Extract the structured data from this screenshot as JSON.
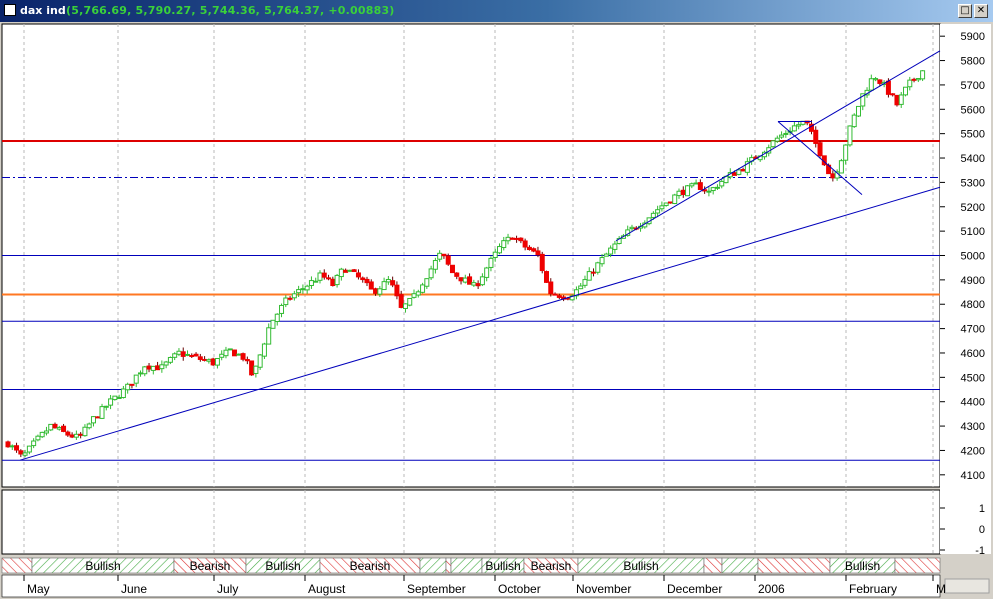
{
  "window": {
    "title": "dax ind",
    "quote": "(5,766.69, 5,790.27, 5,744.36, 5,764.37, +0.00883)",
    "controls": {
      "maximize": "□",
      "close": "✕"
    }
  },
  "colors": {
    "plot_bg": "#ffffff",
    "up_candle": "#33bb33",
    "down_candle": "#ee0000",
    "trend_lines": "#0000bb",
    "resistance_line": "#dd0000",
    "support_line": "#ff7722",
    "grid": "#b8b8b8",
    "bullish_hatch": "#44aa44",
    "bearish_hatch": "#dd3333"
  },
  "chart_data": {
    "type": "candlestick",
    "title": "dax ind",
    "ylim": [
      4050,
      5950
    ],
    "y_ticks": [
      4100,
      4200,
      4300,
      4400,
      4500,
      4600,
      4700,
      4800,
      4900,
      5000,
      5100,
      5200,
      5300,
      5400,
      5500,
      5600,
      5700,
      5800,
      5900
    ],
    "x_tick_labels": [
      "May",
      "June",
      "July",
      "August",
      "September",
      "October",
      "November",
      "December",
      "2006",
      "February",
      "M"
    ],
    "close_series_weekly": [
      {
        "t": 0,
        "c": 4230
      },
      {
        "t": 5,
        "c": 4170
      },
      {
        "t": 10,
        "c": 4240
      },
      {
        "t": 15,
        "c": 4300
      },
      {
        "t": 20,
        "c": 4270
      },
      {
        "t": 25,
        "c": 4250
      },
      {
        "t": 30,
        "c": 4330
      },
      {
        "t": 36,
        "c": 4400
      },
      {
        "t": 42,
        "c": 4460
      },
      {
        "t": 48,
        "c": 4550
      },
      {
        "t": 54,
        "c": 4540
      },
      {
        "t": 60,
        "c": 4600
      },
      {
        "t": 66,
        "c": 4580
      },
      {
        "t": 72,
        "c": 4560
      },
      {
        "t": 78,
        "c": 4610
      },
      {
        "t": 83,
        "c": 4580
      },
      {
        "t": 86,
        "c": 4500
      },
      {
        "t": 92,
        "c": 4720
      },
      {
        "t": 98,
        "c": 4820
      },
      {
        "t": 104,
        "c": 4870
      },
      {
        "t": 110,
        "c": 4920
      },
      {
        "t": 114,
        "c": 4880
      },
      {
        "t": 118,
        "c": 4950
      },
      {
        "t": 124,
        "c": 4900
      },
      {
        "t": 128,
        "c": 4850
      },
      {
        "t": 134,
        "c": 4900
      },
      {
        "t": 138,
        "c": 4780
      },
      {
        "t": 142,
        "c": 4820
      },
      {
        "t": 146,
        "c": 4900
      },
      {
        "t": 152,
        "c": 5010
      },
      {
        "t": 156,
        "c": 4930
      },
      {
        "t": 160,
        "c": 4900
      },
      {
        "t": 164,
        "c": 4870
      },
      {
        "t": 168,
        "c": 4950
      },
      {
        "t": 173,
        "c": 5040
      },
      {
        "t": 177,
        "c": 5080
      },
      {
        "t": 181,
        "c": 5040
      },
      {
        "t": 186,
        "c": 5000
      },
      {
        "t": 190,
        "c": 4850
      },
      {
        "t": 196,
        "c": 4830
      },
      {
        "t": 200,
        "c": 4860
      },
      {
        "t": 206,
        "c": 4950
      },
      {
        "t": 212,
        "c": 5030
      },
      {
        "t": 218,
        "c": 5100
      },
      {
        "t": 224,
        "c": 5150
      },
      {
        "t": 230,
        "c": 5210
      },
      {
        "t": 236,
        "c": 5260
      },
      {
        "t": 242,
        "c": 5290
      },
      {
        "t": 246,
        "c": 5260
      },
      {
        "t": 252,
        "c": 5320
      },
      {
        "t": 258,
        "c": 5360
      },
      {
        "t": 264,
        "c": 5420
      },
      {
        "t": 270,
        "c": 5480
      },
      {
        "t": 276,
        "c": 5530
      },
      {
        "t": 280,
        "c": 5550
      },
      {
        "t": 283,
        "c": 5470
      },
      {
        "t": 286,
        "c": 5400
      },
      {
        "t": 289,
        "c": 5310
      },
      {
        "t": 292,
        "c": 5380
      },
      {
        "t": 296,
        "c": 5540
      },
      {
        "t": 300,
        "c": 5660
      },
      {
        "t": 304,
        "c": 5740
      },
      {
        "t": 308,
        "c": 5690
      },
      {
        "t": 312,
        "c": 5620
      },
      {
        "t": 316,
        "c": 5700
      },
      {
        "t": 322,
        "c": 5770
      }
    ],
    "horizontal_levels": [
      {
        "value": 5470,
        "style": "solid",
        "color": "#dd0000"
      },
      {
        "value": 5320,
        "style": "dash-dot",
        "color": "#0000bb"
      },
      {
        "value": 5000,
        "style": "solid",
        "color": "#0000bb"
      },
      {
        "value": 4840,
        "style": "solid",
        "color": "#ff7722"
      },
      {
        "value": 4730,
        "style": "solid",
        "color": "#0000bb"
      },
      {
        "value": 4450,
        "style": "solid",
        "color": "#0000bb"
      },
      {
        "value": 4160,
        "style": "solid",
        "color": "#0000bb"
      }
    ],
    "lower_panel": {
      "y_ticks": [
        "1",
        "0",
        "-1"
      ]
    },
    "signals": [
      {
        "label": "Bullish",
        "kind": "bullish"
      },
      {
        "label": "Bearish",
        "kind": "bearish"
      },
      {
        "label": "Bullish",
        "kind": "bullish"
      },
      {
        "label": "Bearish",
        "kind": "bearish"
      },
      {
        "label": "Bullish",
        "kind": "bullish"
      },
      {
        "label": "Bearish",
        "kind": "bearish"
      },
      {
        "label": "Bullish",
        "kind": "bullish"
      },
      {
        "label": "Bullish",
        "kind": "bullish"
      }
    ]
  }
}
